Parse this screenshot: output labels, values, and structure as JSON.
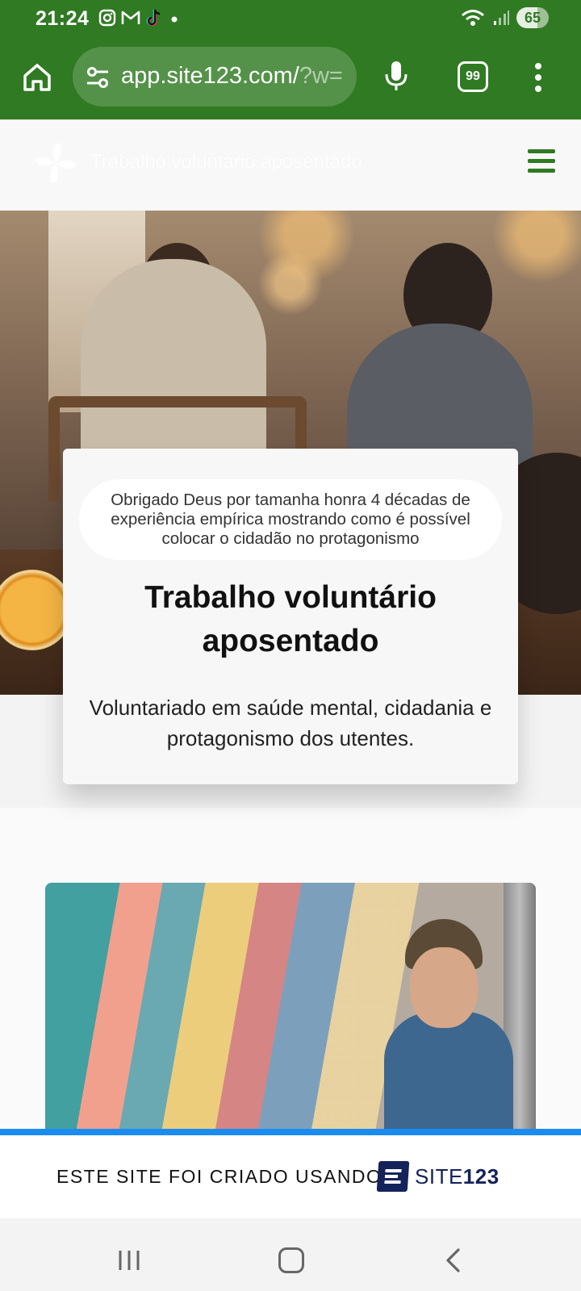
{
  "status_bar": {
    "time": "21:24",
    "notification_icons": [
      "instagram-icon",
      "gmail-icon",
      "tiktok-icon",
      "dot-icon"
    ],
    "battery": "65"
  },
  "browser": {
    "url_main": "app.site123.com/",
    "url_faded": "?w=",
    "tab_count": "99"
  },
  "site": {
    "title": "Trabalho voluntário aposentado"
  },
  "hero_card": {
    "tagline": "Obrigado Deus por tamanha honra 4 décadas de experiência empírica mostrando como é possível colocar o cidadão no protagonismo",
    "title": "Trabalho voluntário aposentado",
    "description": "Voluntariado em saúde mental, cidadania e protagonismo dos utentes."
  },
  "footer_banner": {
    "text": "ESTE SITE FOI CRIADO USANDO",
    "brand_prefix": "SITE",
    "brand_suffix": "123"
  },
  "colors": {
    "browser_green": "#2f7a22",
    "banner_blue": "#1a8cf0",
    "brand_navy": "#14235a"
  }
}
